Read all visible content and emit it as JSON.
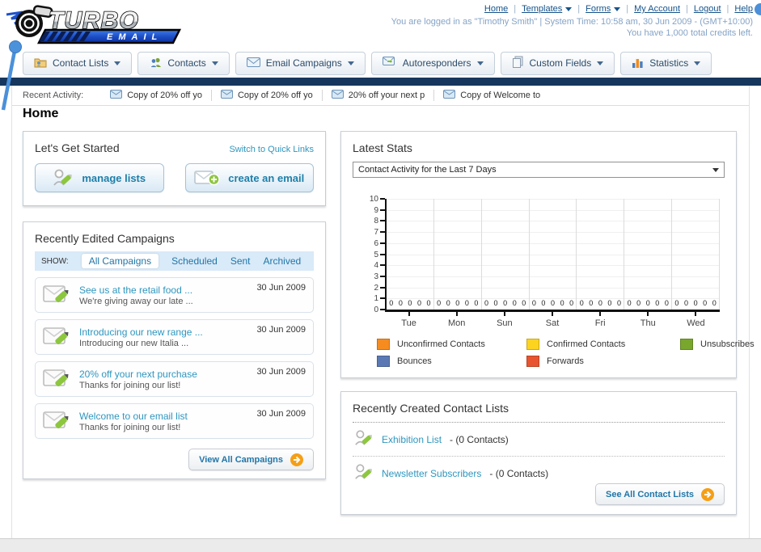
{
  "header": {
    "logo_title": "TURBO",
    "logo_subtitle": "EMAIL",
    "nav": [
      {
        "label": "Home",
        "dropdown": false
      },
      {
        "label": "Templates",
        "dropdown": true
      },
      {
        "label": "Forms",
        "dropdown": true
      },
      {
        "label": "My Account",
        "dropdown": false
      },
      {
        "label": "Logout",
        "dropdown": false
      },
      {
        "label": "Help",
        "dropdown": false
      }
    ],
    "login_info": "You are logged in as \"Timothy Smith\" | System Time: 10:58 am, 30 Jun 2009 - (GMT+10:00)",
    "credits_info": "You have 1,000 total credits left."
  },
  "nav_tabs": [
    {
      "label": "Contact Lists",
      "icon": "contact-lists-folder-icon"
    },
    {
      "label": "Contacts",
      "icon": "contacts-people-icon"
    },
    {
      "label": "Email Campaigns",
      "icon": "email-envelope-icon"
    },
    {
      "label": "Autoresponders",
      "icon": "autoresponder-envelope-icon"
    },
    {
      "label": "Custom Fields",
      "icon": "custom-fields-pages-icon"
    },
    {
      "label": "Statistics",
      "icon": "statistics-chart-icon"
    }
  ],
  "recent_activity": {
    "label": "Recent Activity:",
    "items": [
      {
        "text": "Copy of 20% off yo"
      },
      {
        "text": "Copy of 20% off yo"
      },
      {
        "text": "20% off your next p"
      },
      {
        "text": "Copy of Welcome to"
      }
    ]
  },
  "page_title": "Home",
  "get_started": {
    "title": "Let's Get Started",
    "switch_link": "Switch to Quick Links",
    "manage_lists_label": "manage lists",
    "create_email_label": "create an email"
  },
  "campaigns": {
    "title": "Recently Edited Campaigns",
    "show_label": "SHOW:",
    "filters": [
      {
        "label": "All Campaigns",
        "active": true
      },
      {
        "label": "Scheduled",
        "active": false
      },
      {
        "label": "Sent",
        "active": false
      },
      {
        "label": "Archived",
        "active": false
      }
    ],
    "items": [
      {
        "title": "See us at the retail food ...",
        "subtitle": "We're giving away our late ...",
        "date": "30 Jun 2009"
      },
      {
        "title": "Introducing our new range ...",
        "subtitle": "Introducing our new Italia ...",
        "date": "30 Jun 2009"
      },
      {
        "title": "20% off your next purchase",
        "subtitle": "Thanks for joining our list!",
        "date": "30 Jun 2009"
      },
      {
        "title": "Welcome to our email list",
        "subtitle": "Thanks for joining our list!",
        "date": "30 Jun 2009"
      }
    ],
    "view_all_label": "View All Campaigns"
  },
  "latest_stats": {
    "title": "Latest Stats",
    "period_selected": "Contact Activity for the Last 7 Days"
  },
  "chart_data": {
    "type": "bar",
    "title": "Contact Activity for the Last 7 Days",
    "categories": [
      "Tue",
      "Mon",
      "Sun",
      "Sat",
      "Fri",
      "Thu",
      "Wed"
    ],
    "series": [
      {
        "name": "Unconfirmed Contacts",
        "color": "#F68B1F",
        "values": [
          0,
          0,
          0,
          0,
          0,
          0,
          0
        ]
      },
      {
        "name": "Confirmed Contacts",
        "color": "#FCD41F",
        "values": [
          0,
          0,
          0,
          0,
          0,
          0,
          0
        ]
      },
      {
        "name": "Unsubscribes",
        "color": "#79A62C",
        "values": [
          0,
          0,
          0,
          0,
          0,
          0,
          0
        ]
      },
      {
        "name": "Bounces",
        "color": "#5A79B4",
        "values": [
          0,
          0,
          0,
          0,
          0,
          0,
          0
        ]
      },
      {
        "name": "Forwards",
        "color": "#E8542F",
        "values": [
          0,
          0,
          0,
          0,
          0,
          0,
          0
        ]
      }
    ],
    "ylim": [
      0,
      10
    ],
    "ytick_step": 1,
    "grid": true,
    "legend_position": "bottom",
    "value_labels_shown": true
  },
  "contact_lists": {
    "title": "Recently Created Contact Lists",
    "items": [
      {
        "name": "Exhibition List",
        "suffix": "- (0 Contacts)"
      },
      {
        "name": "Newsletter Subscribers",
        "suffix": "- (0 Contacts)"
      }
    ],
    "see_all_label": "See All Contact Lists"
  }
}
